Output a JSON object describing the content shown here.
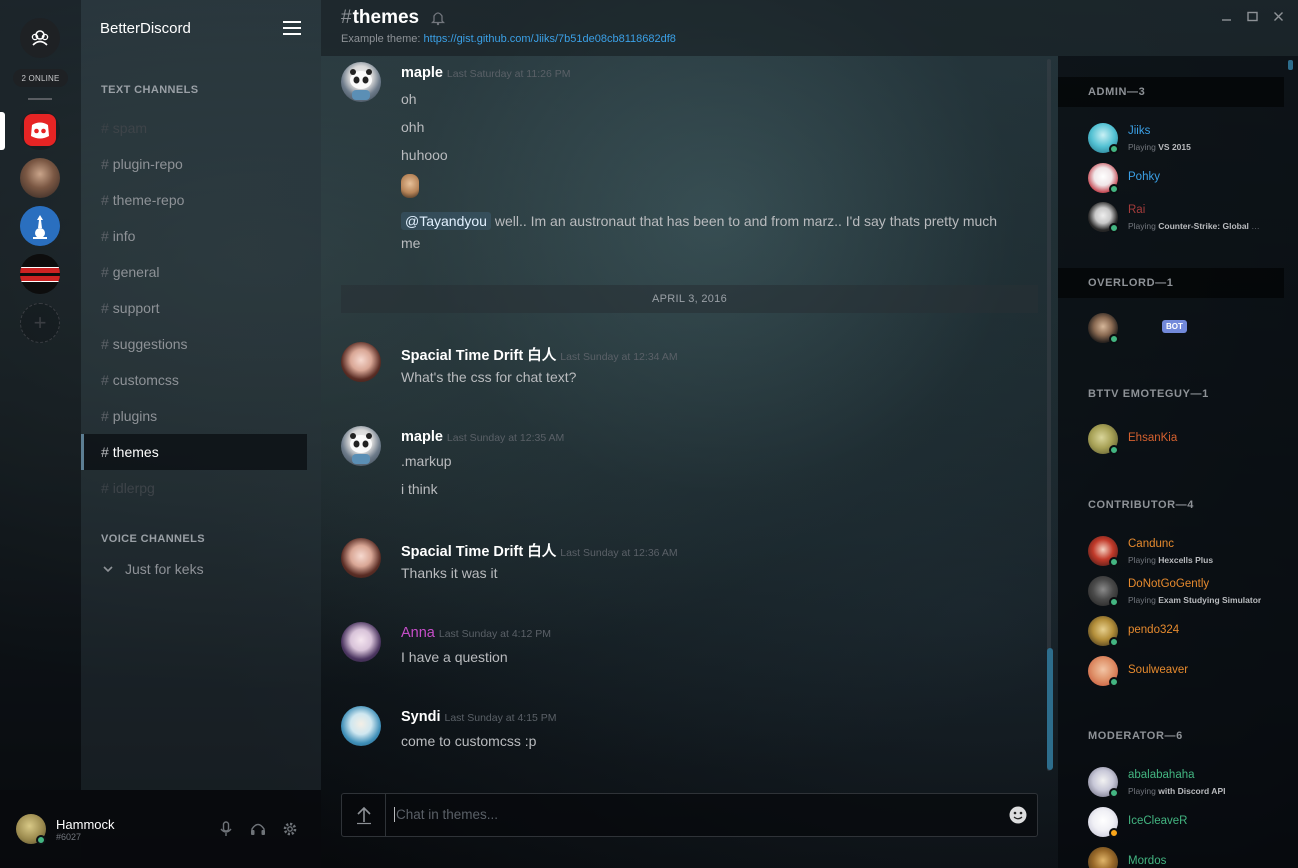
{
  "guild_list": {
    "online_label": "2 ONLINE",
    "add_symbol": "+"
  },
  "guild": {
    "name": "BetterDiscord"
  },
  "text_channels_title": "TEXT CHANNELS",
  "channels": [
    {
      "name": "spam"
    },
    {
      "name": "plugin-repo"
    },
    {
      "name": "theme-repo"
    },
    {
      "name": "info"
    },
    {
      "name": "general"
    },
    {
      "name": "support"
    },
    {
      "name": "suggestions"
    },
    {
      "name": "customcss"
    },
    {
      "name": "plugins"
    },
    {
      "name": "themes"
    },
    {
      "name": "idlerpg"
    }
  ],
  "voice_channels_title": "VOICE CHANNELS",
  "voice_channel": "Just for keks",
  "user": {
    "name": "Hammock",
    "discriminator": "#6027"
  },
  "header": {
    "hash": "#",
    "channel": "themes",
    "topic_label": "Example theme: ",
    "topic_link": "https://gist.github.com/Jiiks/7b51de08cb8118682df8"
  },
  "messages": {
    "m1": {
      "author": "maple",
      "time": "Last Saturday at 11:26 PM",
      "lines": [
        "oh",
        "ohh",
        "huhooo"
      ],
      "mention": "@Tayandyou",
      "mention_text_1": " well.. Im an austronaut that has been to and from marz.. I'd say thats pretty much",
      "mention_text_2": "me"
    },
    "date_divider": "APRIL 3, 2016",
    "m2": {
      "author": "Spacial Time Drift 白人",
      "time": "Last Sunday at 12:34 AM",
      "text": "What's the css for chat text?"
    },
    "m3": {
      "author": "maple",
      "time": "Last Sunday at 12:35 AM",
      "lines": [
        ".markup",
        "i think"
      ]
    },
    "m4": {
      "author": "Spacial Time Drift 白人",
      "time": "Last Sunday at 12:36 AM",
      "text": "Thanks it was it"
    },
    "m5": {
      "author": "Anna",
      "time": "Last Sunday at 4:12 PM",
      "text": "I have a question"
    },
    "m6": {
      "author": "Syndi",
      "time": "Last Sunday at 4:15 PM",
      "text": "come to customcss :p"
    }
  },
  "input": {
    "placeholder": "Chat in themes..."
  },
  "members": {
    "admin": {
      "title": "ADMIN—3",
      "items": [
        {
          "name": "Jiiks",
          "playing_label": "Playing ",
          "game": "VS 2015",
          "color": "#3ba0e6"
        },
        {
          "name": "Pohky",
          "color": "#3ba0e6"
        },
        {
          "name": "Rai",
          "playing_label": "Playing ",
          "game": "Counter-Strike: Global Offensive",
          "color": "#a33b3b"
        }
      ]
    },
    "overlord": {
      "title": "OVERLORD—1",
      "bot_tag": "BOT"
    },
    "bttv": {
      "title": "BTTV EMOTEGUY—1",
      "items": [
        {
          "name": "EhsanKia",
          "color": "#d6612f"
        }
      ]
    },
    "contributor": {
      "title": "CONTRIBUTOR—4",
      "items": [
        {
          "name": "Candunc",
          "playing_label": "Playing ",
          "game": "Hexcells Plus",
          "color": "#e68a2e"
        },
        {
          "name": "DoNotGoGently",
          "playing_label": "Playing ",
          "game": "Exam Studying Simulator",
          "color": "#e68a2e"
        },
        {
          "name": "pendo324",
          "color": "#e68a2e"
        },
        {
          "name": "Soulweaver",
          "color": "#e68a2e"
        }
      ]
    },
    "moderator": {
      "title": "MODERATOR—6",
      "items": [
        {
          "name": "abalabahaha",
          "playing_label": "Playing ",
          "game": "with Discord API",
          "color": "#43b581"
        },
        {
          "name": "IceCleaveR",
          "color": "#43b581"
        },
        {
          "name": "Mordos",
          "color": "#43b581"
        }
      ]
    }
  },
  "colors": {
    "accent": "#3ba0e6",
    "online": "#43b581",
    "idle": "#faa61a",
    "scroll_thumb": "#2d6d8c"
  }
}
